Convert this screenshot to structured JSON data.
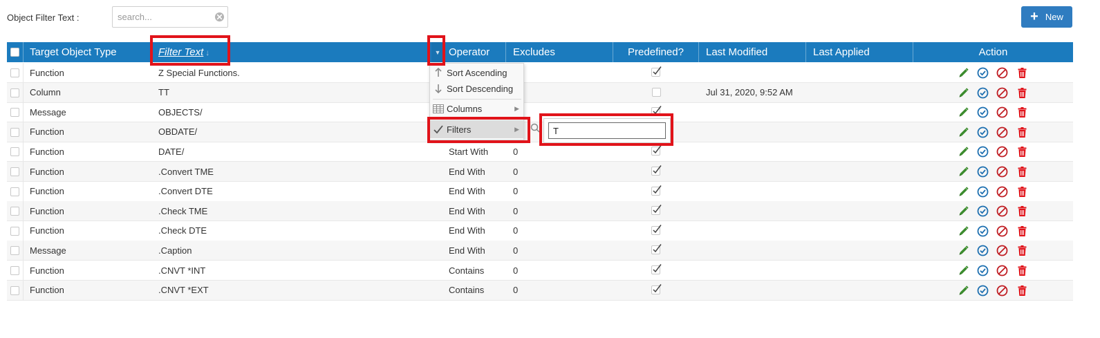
{
  "toolbar": {
    "filter_label": "Object Filter Text :",
    "search_placeholder": "search...",
    "new_label": "New"
  },
  "colors": {
    "header_bg": "#1b7bbe",
    "new_button": "#2f7cc0",
    "edit_icon": "#3c8c2e",
    "apply_icon": "#1d6fb0",
    "disable_icon": "#c01e24",
    "delete_icon": "#e1131a",
    "highlight": "#e1131a"
  },
  "grid": {
    "columns": {
      "target_object_type": "Target Object Type",
      "filter_text": "Filter Text",
      "sort_arrow": "↓",
      "operator": "Operator",
      "excludes": "Excludes",
      "predefined": "Predefined?",
      "last_modified": "Last Modified",
      "last_applied": "Last Applied",
      "action": "Action"
    },
    "rows": [
      {
        "type": "Function",
        "text": "Z Special Functions.",
        "operator": "",
        "excludes": "",
        "predefined": true,
        "last_modified": "",
        "last_applied": ""
      },
      {
        "type": "Column",
        "text": "TT",
        "operator": "",
        "excludes": "",
        "predefined": false,
        "last_modified": "Jul 31, 2020, 9:52 AM",
        "last_applied": ""
      },
      {
        "type": "Message",
        "text": "OBJECTS/",
        "operator": "",
        "excludes": "",
        "predefined": true,
        "last_modified": "",
        "last_applied": ""
      },
      {
        "type": "Function",
        "text": "OBDATE/",
        "operator": "",
        "excludes": "",
        "predefined": true,
        "last_modified": "",
        "last_applied": ""
      },
      {
        "type": "Function",
        "text": "DATE/",
        "operator": "Start With",
        "excludes": "0",
        "predefined": true,
        "last_modified": "",
        "last_applied": ""
      },
      {
        "type": "Function",
        "text": ".Convert TME",
        "operator": "End With",
        "excludes": "0",
        "predefined": true,
        "last_modified": "",
        "last_applied": ""
      },
      {
        "type": "Function",
        "text": ".Convert DTE",
        "operator": "End With",
        "excludes": "0",
        "predefined": true,
        "last_modified": "",
        "last_applied": ""
      },
      {
        "type": "Function",
        "text": ".Check TME",
        "operator": "End With",
        "excludes": "0",
        "predefined": true,
        "last_modified": "",
        "last_applied": ""
      },
      {
        "type": "Function",
        "text": ".Check DTE",
        "operator": "End With",
        "excludes": "0",
        "predefined": true,
        "last_modified": "",
        "last_applied": ""
      },
      {
        "type": "Message",
        "text": ".Caption",
        "operator": "End With",
        "excludes": "0",
        "predefined": true,
        "last_modified": "",
        "last_applied": ""
      },
      {
        "type": "Function",
        "text": ".CNVT *INT",
        "operator": "Contains",
        "excludes": "0",
        "predefined": true,
        "last_modified": "",
        "last_applied": ""
      },
      {
        "type": "Function",
        "text": ".CNVT *EXT",
        "operator": "Contains",
        "excludes": "0",
        "predefined": true,
        "last_modified": "",
        "last_applied": ""
      }
    ]
  },
  "column_menu": {
    "sort_ascending": "Sort Ascending",
    "sort_descending": "Sort Descending",
    "columns": "Columns",
    "filters": "Filters",
    "filter_value": "T"
  },
  "icons": {
    "clear": "clear-circle-icon",
    "new": "plus-icon",
    "menu": "caret-down-icon",
    "sort_asc": "arrow-up-icon",
    "sort_desc": "arrow-down-icon",
    "columns": "columns-icon",
    "filters": "check-icon",
    "submenu": "chevron-right-icon",
    "filter_search": "magnifier-icon",
    "predefined": "checkmark-icon",
    "edit": "pencil-icon",
    "apply": "check-circle-icon",
    "disable": "ban-icon",
    "delete": "trash-icon"
  }
}
